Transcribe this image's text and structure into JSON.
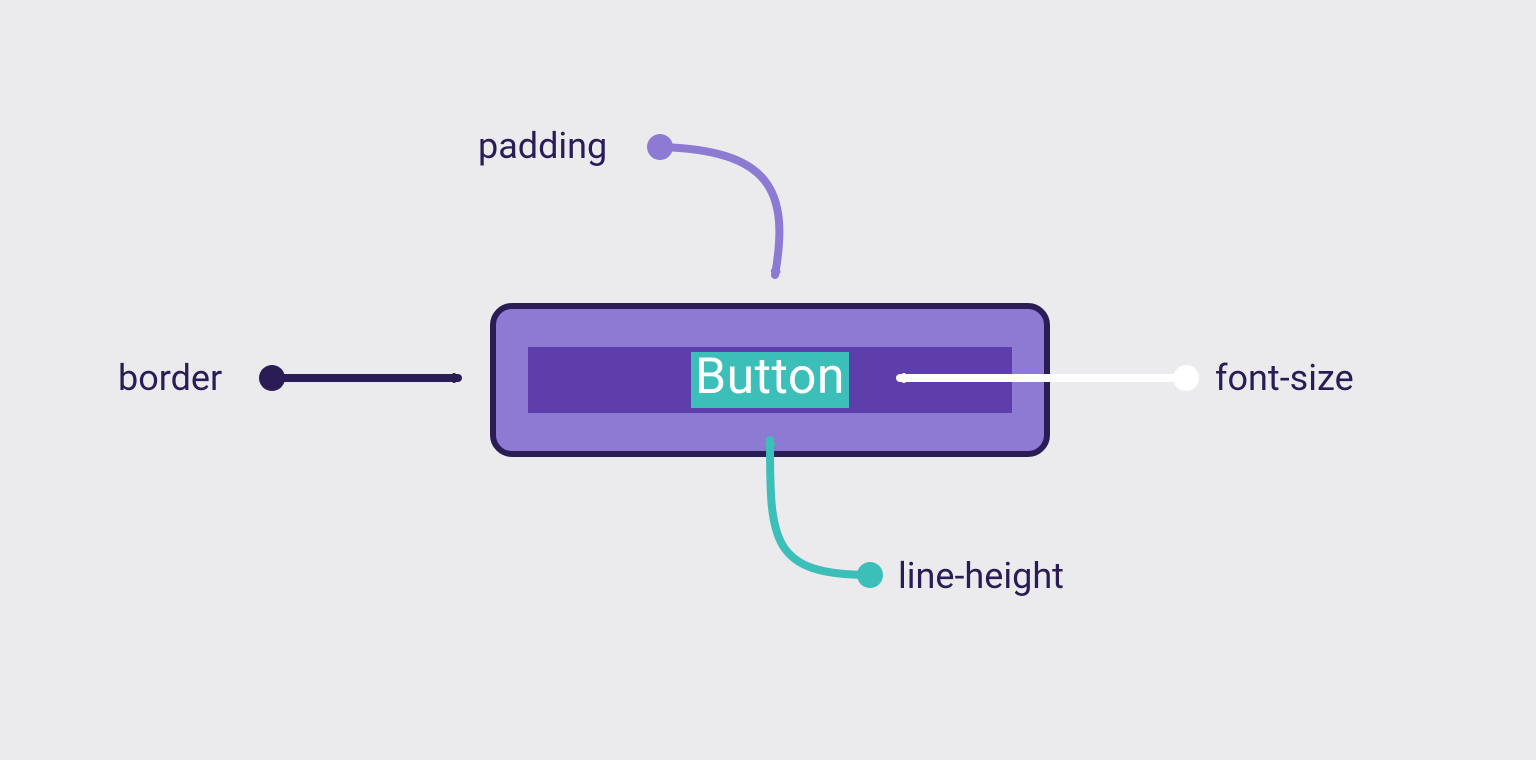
{
  "labels": {
    "padding": "padding",
    "border": "border",
    "font_size": "font-size",
    "line_height": "line-height"
  },
  "button": {
    "text": "Button"
  },
  "colors": {
    "background": "#ebebed",
    "border_arrow": "#2a1d55",
    "padding_arrow": "#8c7ad3",
    "font_size_arrow": "#ffffff",
    "line_height_arrow": "#3cbfb8",
    "button_fill": "#8c7ad3",
    "button_border": "#2a1d55",
    "line_height_box": "#5e3eaa",
    "font_box": "#3cbfb8",
    "text_color": "#ffffff",
    "label_color": "#2a1d55"
  },
  "diagram_meaning": {
    "border": "points to the outer stroke of the button",
    "padding": "points to the space between border and inner content",
    "font_size": "points to the glyph height box of the text",
    "line_height": "points to the line box containing the text"
  }
}
